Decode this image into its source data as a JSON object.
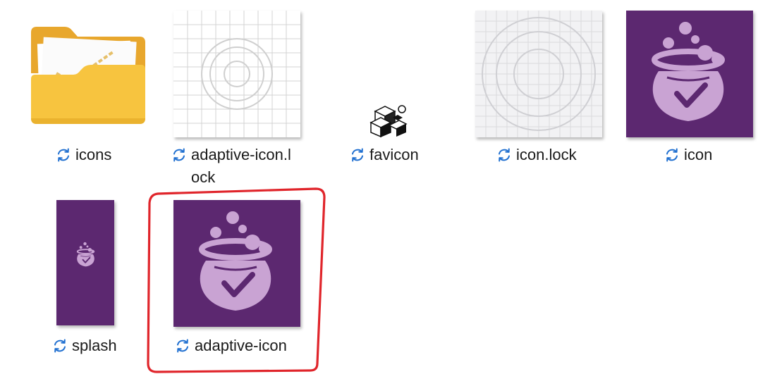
{
  "files": [
    {
      "key": "icons",
      "name": "icons",
      "type": "folder",
      "status_icon": "sync-pending-icon"
    },
    {
      "key": "adaptive_icon_lock",
      "name": "adaptive-icon.l",
      "name_cont": "ock",
      "type": "image",
      "status_icon": "sync-pending-icon"
    },
    {
      "key": "favicon",
      "name": "favicon",
      "type": "image",
      "status_icon": "sync-pending-icon"
    },
    {
      "key": "icon_lock",
      "name": "icon.lock",
      "type": "image",
      "status_icon": "sync-pending-icon"
    },
    {
      "key": "icon",
      "name": "icon",
      "type": "image",
      "status_icon": "sync-pending-icon"
    },
    {
      "key": "splash",
      "name": "splash",
      "type": "image",
      "status_icon": "sync-pending-icon"
    },
    {
      "key": "adaptive_icon",
      "name": "adaptive-icon",
      "type": "image",
      "status_icon": "sync-pending-icon",
      "annotated": true
    }
  ],
  "colors": {
    "brand_purple": "#5c2870",
    "pot_fill": "#c9a3d3",
    "sync_blue": "#1f6fd0",
    "folder_yellow": "#f7c43f",
    "annotation_red": "#e0252b",
    "grid_bg": "#ffffff",
    "grid_bg_alt": "#f2f2f4",
    "grid_line": "#d0d0d0"
  }
}
